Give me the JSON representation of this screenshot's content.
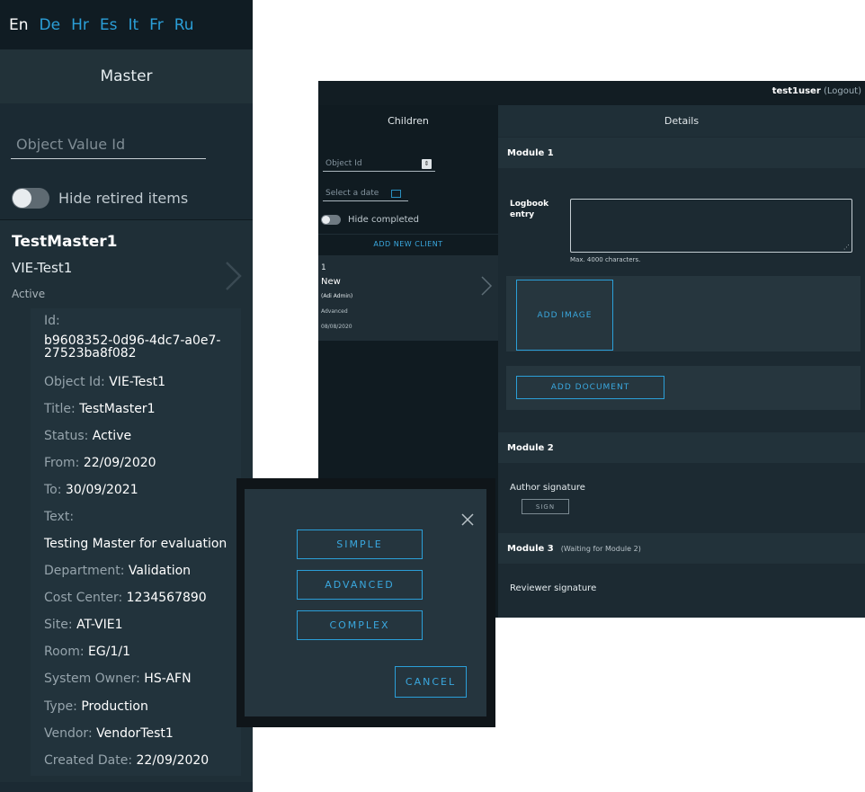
{
  "languages": [
    "En",
    "De",
    "Hr",
    "Es",
    "It",
    "Fr",
    "Ru"
  ],
  "active_language": "En",
  "master_panel": {
    "heading": "Master",
    "search_placeholder": "Object Value Id",
    "hide_retired_label": "Hide retired items",
    "hide_retired_on": false,
    "card": {
      "title": "TestMaster1",
      "subtitle": "VIE-Test1",
      "status": "Active",
      "details": {
        "id_label": "Id:",
        "id_value": "b9608352-0d96-4dc7-a0e7-27523ba8f082",
        "object_id_label": "Object Id:",
        "object_id_value": "VIE-Test1",
        "title_label": "Title:",
        "title_value": "TestMaster1",
        "status_label": "Status:",
        "status_value": "Active",
        "from_label": "From:",
        "from_value": "22/09/2020",
        "to_label": "To:",
        "to_value": "30/09/2021",
        "text_label": "Text:",
        "text_value": "Testing Master for evaluation",
        "department_label": "Department:",
        "department_value": "Validation",
        "cost_center_label": "Cost Center:",
        "cost_center_value": "1234567890",
        "site_label": "Site:",
        "site_value": "AT-VIE1",
        "room_label": "Room:",
        "room_value": "EG/1/1",
        "system_owner_label": "System Owner:",
        "system_owner_value": "HS-AFN",
        "type_label": "Type:",
        "type_value": "Production",
        "vendor_label": "Vendor:",
        "vendor_value": "VendorTest1",
        "created_date_label": "Created Date:",
        "created_date_value": "22/09/2020"
      }
    }
  },
  "app": {
    "user": "test1user",
    "logout": "(Logout)",
    "children": {
      "heading": "Children",
      "object_id_placeholder": "Object Id",
      "date_placeholder": "Select a date",
      "hide_completed_label": "Hide completed",
      "hide_completed_on": false,
      "add_client_label": "ADD NEW CLIENT",
      "item": {
        "number": "1",
        "status": "New",
        "author": "(Adi Admin)",
        "type": "Advanced",
        "date": "08/08/2020"
      }
    },
    "details": {
      "heading": "Details",
      "module1": "Module 1",
      "logbook_label": "Logbook entry",
      "logbook_hint": "Max. 4000 characters.",
      "add_image": "ADD IMAGE",
      "add_document": "ADD DOCUMENT",
      "module2": "Module 2",
      "author_signature": "Author signature",
      "sign": "SIGN",
      "module3": "Module 3",
      "module3_note": "(Waiting for Module 2)",
      "reviewer_signature": "Reviewer signature"
    }
  },
  "dialog": {
    "options": [
      "SIMPLE",
      "ADVANCED",
      "COMPLEX"
    ],
    "cancel": "CANCEL"
  },
  "colors": {
    "accent": "#2b9fd8",
    "panel_dark": "#1b2a33",
    "panel_header": "#223239"
  }
}
